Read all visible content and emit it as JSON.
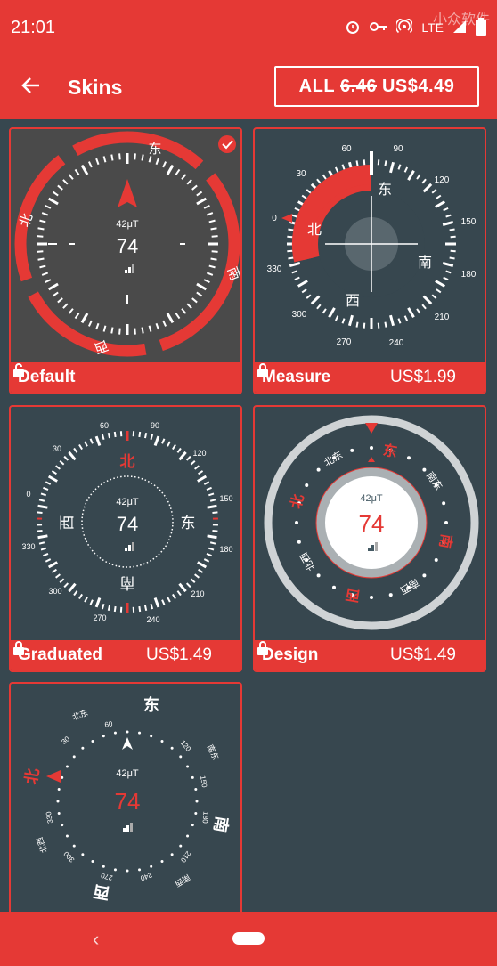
{
  "status_bar": {
    "time": "21:01",
    "network": "LTE",
    "watermark": "小众软件"
  },
  "app_bar": {
    "title": "Skins",
    "buy_all": {
      "label": "ALL",
      "old_price": "6.46",
      "new_price": "US$4.49"
    }
  },
  "skins": [
    {
      "name": "Default",
      "price": "",
      "lock": "unlocked",
      "selected": true,
      "dial": {
        "field": "42μT",
        "value": "74",
        "dirs": [
          "东",
          "北",
          "南",
          "西"
        ]
      }
    },
    {
      "name": "Measure",
      "price": "US$1.99",
      "lock": "locked",
      "selected": false,
      "dial": {
        "dirs": [
          "东",
          "北",
          "南",
          "西"
        ],
        "degrees": [
          "60",
          "90",
          "30",
          "120",
          "0",
          "150",
          "180",
          "330",
          "210",
          "300",
          "270",
          "240"
        ]
      }
    },
    {
      "name": "Graduated",
      "price": "US$1.49",
      "lock": "locked",
      "selected": false,
      "dial": {
        "field": "42μT",
        "value": "74",
        "dirs": [
          "北",
          "西",
          "东",
          "南"
        ],
        "degrees": [
          "60",
          "90",
          "30",
          "120",
          "0",
          "150",
          "180",
          "330",
          "210",
          "300",
          "240",
          "270"
        ]
      }
    },
    {
      "name": "Design",
      "price": "US$1.49",
      "lock": "locked",
      "selected": false,
      "dial": {
        "field": "42μT",
        "value": "74",
        "dirs": [
          "东",
          "北",
          "南",
          "西"
        ],
        "inter": [
          "北东",
          "南东",
          "北西",
          "南西"
        ]
      }
    },
    {
      "name": "",
      "price": "",
      "lock": "",
      "selected": false,
      "dial": {
        "field": "42μT",
        "value": "74",
        "dirs": [
          "东",
          "北",
          "南",
          "西"
        ],
        "inter": [
          "北东",
          "南东",
          "北西",
          "南西"
        ],
        "degrees": [
          "60",
          "120",
          "150",
          "180",
          "210",
          "240",
          "270",
          "300",
          "330",
          "30"
        ]
      }
    }
  ],
  "colors": {
    "accent": "#e53935",
    "background": "#37474f",
    "dark_dial": "#4a4a4a"
  },
  "icons": [
    "alarm-icon",
    "key-icon",
    "hotspot-icon",
    "signal-icon",
    "battery-icon",
    "back-arrow-icon",
    "check-circle-icon",
    "unlock-icon",
    "lock-icon"
  ]
}
